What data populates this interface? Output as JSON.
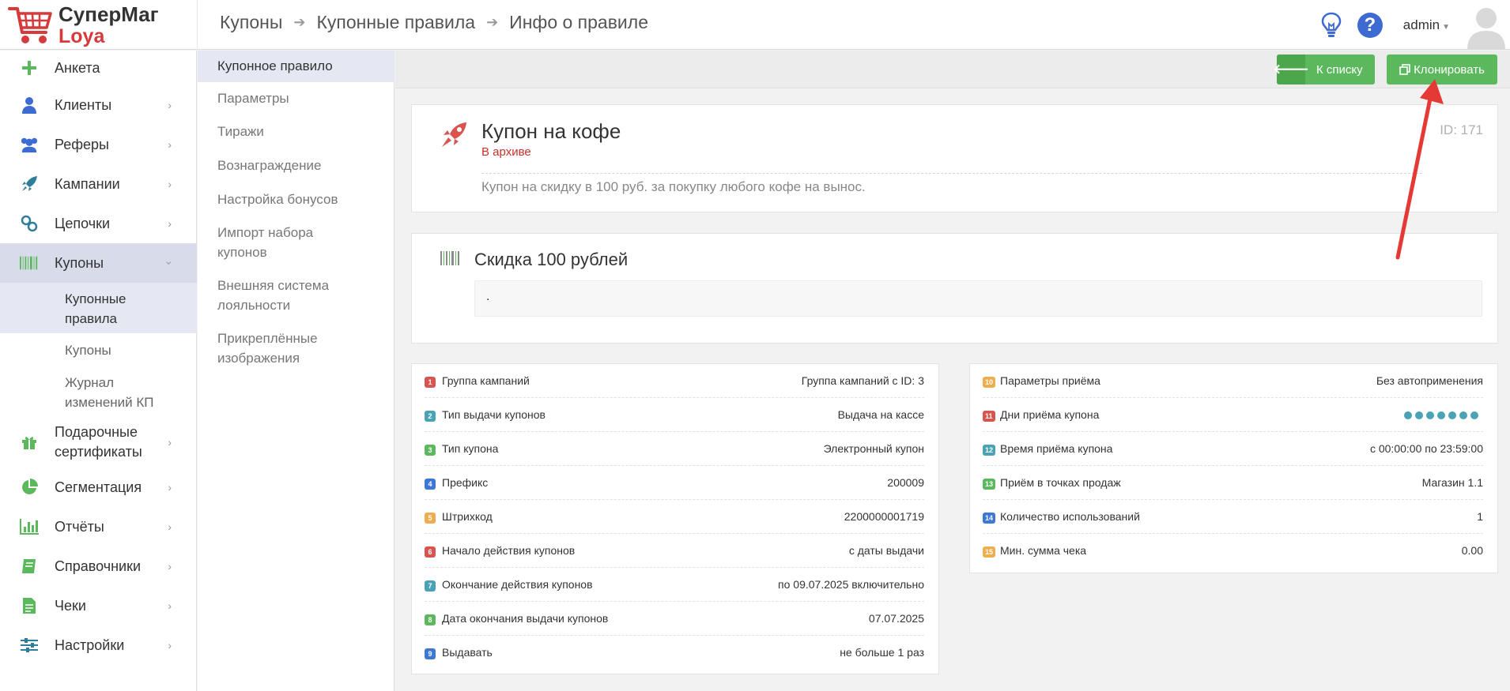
{
  "header": {
    "logo_line1": "СуперМаг",
    "logo_line2": "Loya",
    "breadcrumb": [
      "Купоны",
      "Купонные правила",
      "Инфо о правиле"
    ],
    "user": "admin"
  },
  "sidebar": {
    "items": [
      {
        "label": "Анкета",
        "icon": "plus-icon"
      },
      {
        "label": "Клиенты",
        "icon": "user-icon"
      },
      {
        "label": "Реферы",
        "icon": "users-icon"
      },
      {
        "label": "Кампании",
        "icon": "rocket-icon"
      },
      {
        "label": "Цепочки",
        "icon": "link-icon"
      },
      {
        "label": "Купоны",
        "icon": "barcode-icon"
      },
      {
        "label": "Подарочные сертификаты",
        "icon": "gift-icon"
      },
      {
        "label": "Сегментация",
        "icon": "pie-chart-icon"
      },
      {
        "label": "Отчёты",
        "icon": "bar-chart-icon"
      },
      {
        "label": "Справочники",
        "icon": "book-icon"
      },
      {
        "label": "Чеки",
        "icon": "receipt-icon"
      },
      {
        "label": "Настройки",
        "icon": "sliders-icon"
      }
    ],
    "sub_items": [
      "Купонные правила",
      "Купоны",
      "Журнал изменений КП"
    ]
  },
  "subnav": {
    "items": [
      "Купонное правило",
      "Параметры",
      "Тиражи",
      "Вознаграждение",
      "Настройка бонусов",
      "Импорт набора купонов",
      "Внешняя система лояльности",
      "Прикреплённые изображения"
    ]
  },
  "toolbar": {
    "back_label": "К списку",
    "clone_label": "Клонировать"
  },
  "rule": {
    "title": "Купон на кофе",
    "status": "В архиве",
    "id": "ID: 171",
    "description": "Купон на скидку в 100 руб. за покупку любого кофе на вынос."
  },
  "reward": {
    "title": "Скидка 100 рублей",
    "text": "."
  },
  "params_left": [
    {
      "n": "1",
      "color": "#d9534f",
      "key": "Группа кампаний",
      "value": "Группа кампаний с ID: 3"
    },
    {
      "n": "2",
      "color": "#4aa3b5",
      "key": "Тип выдачи купонов",
      "value": "Выдача на кассе"
    },
    {
      "n": "3",
      "color": "#5cb85c",
      "key": "Тип купона",
      "value": "Электронный купон"
    },
    {
      "n": "4",
      "color": "#3c78d8",
      "key": "Префикс",
      "value": "200009"
    },
    {
      "n": "5",
      "color": "#f0ad4e",
      "key": "Штрихкод",
      "value": "2200000001719"
    },
    {
      "n": "6",
      "color": "#d9534f",
      "key": "Начало действия купонов",
      "value": "с даты выдачи"
    },
    {
      "n": "7",
      "color": "#4aa3b5",
      "key": "Окончание действия купонов",
      "value": "по 09.07.2025 включительно"
    },
    {
      "n": "8",
      "color": "#5cb85c",
      "key": "Дата окончания выдачи купонов",
      "value": "07.07.2025"
    },
    {
      "n": "9",
      "color": "#3c78d8",
      "key": "Выдавать",
      "value": "не больше 1 раз"
    }
  ],
  "params_right": [
    {
      "n": "10",
      "color": "#f0ad4e",
      "key": "Параметры приёма",
      "value": "Без автоприменения"
    },
    {
      "n": "11",
      "color": "#d9534f",
      "key": "Дни приёма купона",
      "value": ""
    },
    {
      "n": "12",
      "color": "#4aa3b5",
      "key": "Время приёма купона",
      "value": "с 00:00:00 по 23:59:00"
    },
    {
      "n": "13",
      "color": "#5cb85c",
      "key": "Приём в точках продаж",
      "value": "Магазин 1.1"
    },
    {
      "n": "14",
      "color": "#3c78d8",
      "key": "Количество использований",
      "value": "1"
    },
    {
      "n": "15",
      "color": "#f0ad4e",
      "key": "Мин. сумма чека",
      "value": "0.00"
    }
  ]
}
